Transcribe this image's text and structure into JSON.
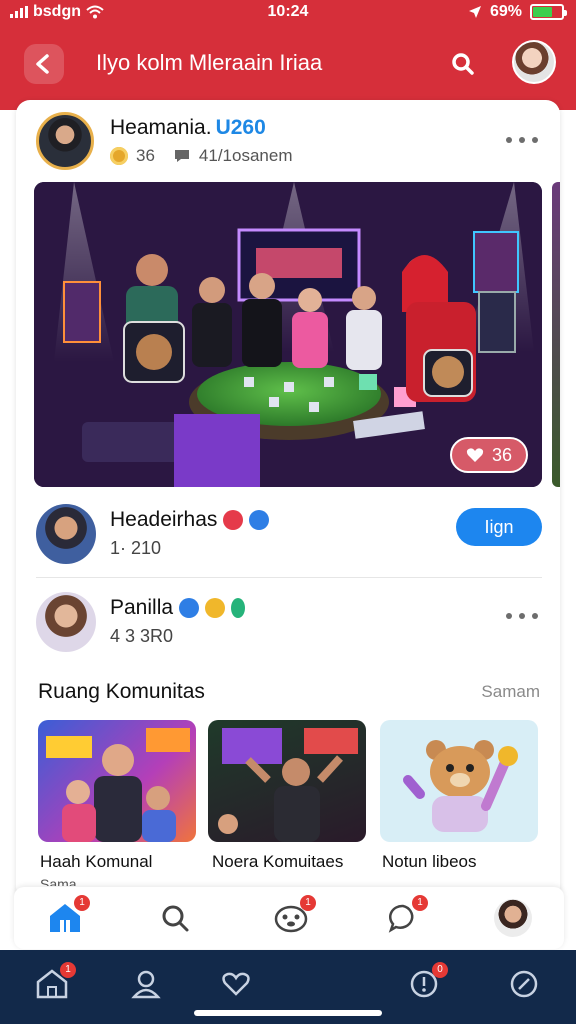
{
  "status_bar": {
    "carrier": "bsdgn",
    "time": "10:24",
    "battery": "69%"
  },
  "header": {
    "title": "Ilyo kolm Mleraain Iriaa"
  },
  "post": {
    "author": "Heamania.",
    "badge": "U260",
    "coins": "36",
    "meta": "41/1osanem",
    "reaction_count": "36"
  },
  "rows": [
    {
      "name": "Headeirhas",
      "sub": "1·  210",
      "button": "Iign"
    },
    {
      "name": "Panilla",
      "sub": "4 3 3R0"
    }
  ],
  "section": {
    "title": "Ruang Komunitas",
    "see_all": "Samam",
    "tiles": [
      {
        "label": "Haah Komunal",
        "sub": "Sama"
      },
      {
        "label": "Noera Komuitaes"
      },
      {
        "label": "Notun libeos"
      }
    ]
  },
  "bottom_tabs": {
    "home_badge": "1",
    "game_badge": "1",
    "chat_badge": "1"
  },
  "nav_bar": {
    "home_badge": "1",
    "alert_badge": "0"
  },
  "colors": {
    "brand_red": "#d62f3a",
    "accent_blue": "#1d86ef",
    "nav_navy": "#12294a"
  },
  "icons": [
    "back-icon",
    "search-icon",
    "more-icon",
    "home-icon",
    "game-icon",
    "chat-icon",
    "profile-icon",
    "heart-icon",
    "alert-icon",
    "compass-icon"
  ]
}
